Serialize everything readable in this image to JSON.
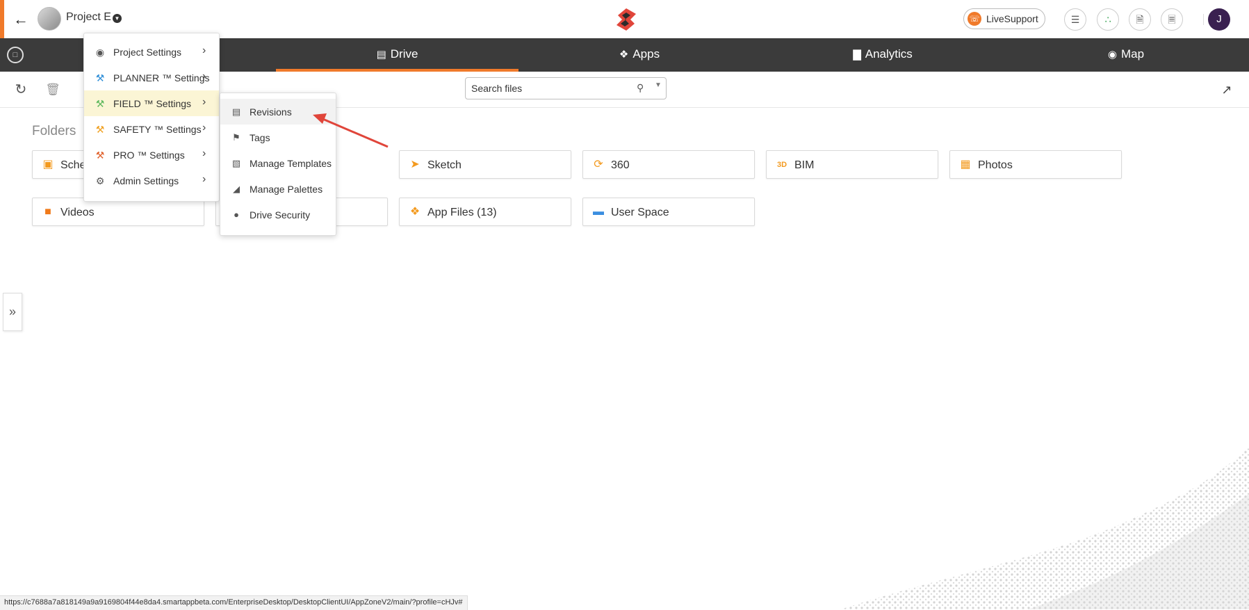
{
  "header": {
    "project_name": "Project E",
    "live_support_label": "LiveSupport",
    "user_initial": "J"
  },
  "nav": {
    "tabs": [
      {
        "label": "Drive",
        "icon": "drive-icon",
        "active": true
      },
      {
        "label": "Apps",
        "icon": "apps-icon",
        "active": false
      },
      {
        "label": "Analytics",
        "icon": "analytics-icon",
        "active": false
      },
      {
        "label": "Map",
        "icon": "map-pin-icon",
        "active": false
      }
    ]
  },
  "toolbar": {
    "search_placeholder": "Search files"
  },
  "folders": {
    "title": "Folders",
    "items": [
      {
        "label": "Sche",
        "icon": "calendar-icon"
      },
      {
        "label": "Sketch",
        "icon": "sketch-icon"
      },
      {
        "label": "360",
        "icon": "360-icon"
      },
      {
        "label": "BIM",
        "icon": "bim-3d-icon"
      },
      {
        "label": "Photos",
        "icon": "photos-icon"
      },
      {
        "label": "Videos",
        "icon": "video-icon"
      },
      {
        "label": "App Files (13)",
        "icon": "app-files-icon"
      },
      {
        "label": "User Space",
        "icon": "user-space-icon"
      }
    ]
  },
  "settings_menu": {
    "items": [
      {
        "label": "Project Settings",
        "icon": "camera-icon",
        "color": "#555555"
      },
      {
        "label": "PLANNER ™ Settings",
        "icon": "planner-hammer-icon",
        "color": "#2f8fd8"
      },
      {
        "label": "FIELD ™ Settings",
        "icon": "field-hammer-icon",
        "color": "#5cb85c"
      },
      {
        "label": "SAFETY ™ Settings",
        "icon": "safety-hammer-icon",
        "color": "#f0a020"
      },
      {
        "label": "PRO ™ Settings",
        "icon": "pro-hammer-icon",
        "color": "#e0602a"
      },
      {
        "label": "Admin Settings",
        "icon": "admin-user-gear-icon",
        "color": "#555555"
      }
    ]
  },
  "field_submenu": {
    "items": [
      {
        "label": "Revisions",
        "icon": "revisions-icon"
      },
      {
        "label": "Tags",
        "icon": "tag-icon"
      },
      {
        "label": "Manage Templates",
        "icon": "template-icon"
      },
      {
        "label": "Manage Palettes",
        "icon": "palette-icon"
      },
      {
        "label": "Drive Security",
        "icon": "lock-icon"
      }
    ]
  },
  "status_bar": {
    "url": "https://c7688a7a818149a9a9169804f44e8da4.smartappbeta.com/EnterpriseDesktop/DesktopClientUI/AppZoneV2/main/?profile=cHJv#"
  },
  "colors": {
    "accent": "#f07a2a",
    "navbar": "#3b3b3b",
    "highlight": "#fbf5d5",
    "arrow": "#e0453a"
  }
}
